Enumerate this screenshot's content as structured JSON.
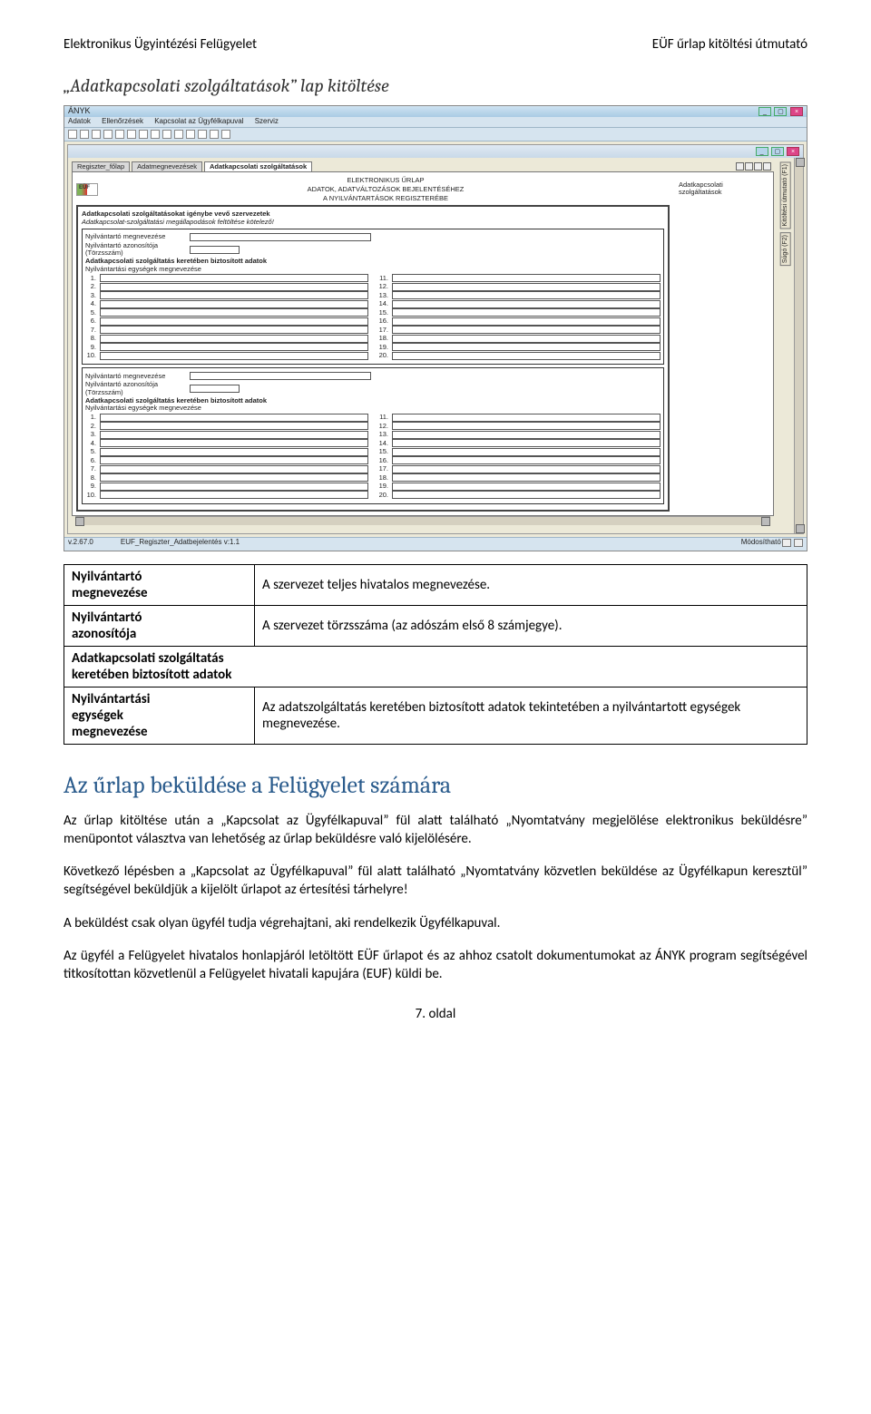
{
  "doc": {
    "header_left": "Elektronikus Ügyintézési Felügyelet",
    "header_right": "EÜF űrlap kitöltési útmutató",
    "section_title": "„Adatkapcsolati szolgáltatások” lap kitöltése"
  },
  "app": {
    "title": "ÁNYK",
    "menu": {
      "m1": "Adatok",
      "m2": "Ellenőrzések",
      "m3": "Kapcsolat az Ügyfélkapuval",
      "m4": "Szerviz"
    },
    "tabs": {
      "t1": "Regiszter_főlap",
      "t2": "Adatmegnevezések",
      "t3": "Adatkapcsolati szolgáltatások"
    },
    "side": {
      "s1": "Kitöltési útmutató (F1)",
      "s2": "Súgó (F2)"
    },
    "form_head": {
      "l1": "ELEKTRONIKUS ŰRLAP",
      "l2": "ADATOK, ADATVÁLTOZÁSOK BEJELENTÉSÉHEZ",
      "l3": "A NYILVÁNTARTÁSOK REGISZTERÉBE",
      "right1": "Adatkapcsolati",
      "right2": "szolgáltatások"
    },
    "section": {
      "h1": "Adatkapcsolati szolgáltatásokat igénybe vevő szervezetek",
      "h2": "Adatkapcsolat-szolgáltatási megállapodások feltöltése kötelező!"
    },
    "block": {
      "f1": "Nyilvántartó megnevezése",
      "f2a": "Nyilvántartó azonosítója",
      "f2b": "(Törzsszám)",
      "f3": "Adatkapcsolati szolgáltatás keretében biztosított adatok",
      "f4": "Nyilvántartási egységek megnevezése"
    },
    "status": {
      "v": "v.2.67.0",
      "file": "EUF_Regiszter_Adatbejelentés v:1.1",
      "state": "Módosítható"
    }
  },
  "table": {
    "r1l": "Nyilvántartó\nmegnevezése",
    "r1v": "A szervezet teljes hivatalos megnevezése.",
    "r2l": "Nyilvántartó\nazonosítója",
    "r2v": "A szervezet törzsszáma (az adószám első 8 számjegye).",
    "r3": "Adatkapcsolati szolgáltatás\nkeretében biztosított adatok",
    "r4l": "Nyilvántartási\negységek\nmegnevezése",
    "r4v": "Az adatszolgáltatás keretében biztosított adatok tekintetében a nyilvántartott egységek megnevezése."
  },
  "body": {
    "h": "Az űrlap beküldése a Felügyelet számára",
    "p1": "Az űrlap kitöltése után a „Kapcsolat az Ügyfélkapuval” fül alatt található „Nyomtatvány megjelölése elektronikus beküldésre” menüpontot választva van lehetőség az űrlap beküldésre való kijelölésére.",
    "p2": "Következő lépésben a „Kapcsolat az Ügyfélkapuval” fül alatt található „Nyomtatvány közvetlen beküldése az Ügyfélkapun keresztül” segítségével beküldjük a kijelölt űrlapot az értesítési tárhelyre!",
    "p3": "A beküldést csak olyan ügyfél tudja végrehajtani, aki rendelkezik Ügyfélkapuval.",
    "p4": "Az ügyfél a Felügyelet hivatalos honlapjáról letöltött EÜF űrlapot és az ahhoz csatolt dokumentumokat az ÁNYK program segítségével titkosítottan közvetlenül a Felügyelet hivatali kapujára (EUF) küldi be.",
    "footer": "7. oldal"
  }
}
